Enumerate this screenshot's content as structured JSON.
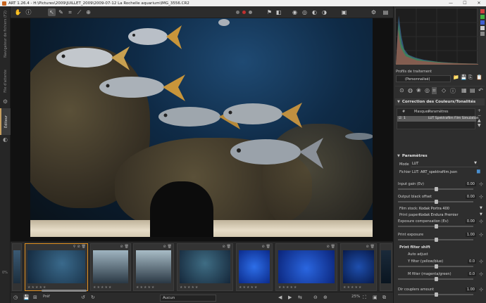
{
  "window": {
    "title": "ART 1.26.4 - H:\\Pictures\\2009\\JUILLET_2009\\2009-07-12 La Rochelle aquarium\\IMG_3556.CR2",
    "minimize": "—",
    "maximize": "☐",
    "close": "✕"
  },
  "left_tabs": {
    "browser": "Navigateur de fichiers (F2)",
    "queue": "File d'attente",
    "editor": "Éditeur"
  },
  "toolbar": {
    "icons": [
      "hand-tool",
      "info",
      "crop",
      "pipette",
      "white-balance",
      "straighten",
      "select"
    ]
  },
  "filmstrip": {
    "thumbnails": [
      {
        "id": "partial-left",
        "stars": ""
      },
      {
        "id": "fish-school",
        "stars": "★★★★★"
      },
      {
        "id": "diver-tank",
        "stars": "★★★★★"
      },
      {
        "id": "diver-tank-2",
        "stars": "★★★★★"
      },
      {
        "id": "fish-group",
        "stars": "★★★★★"
      },
      {
        "id": "jellyfish-blue",
        "stars": "★★★★★"
      },
      {
        "id": "jellyfish-wide",
        "stars": "★★★★★"
      },
      {
        "id": "moon-jelly",
        "stars": "★★★★★"
      },
      {
        "id": "partial-right",
        "stars": ""
      }
    ]
  },
  "bottombar": {
    "left_label": "0%",
    "preset_label": "Aucun",
    "fit_label": "Préf",
    "zoom": "25%"
  },
  "right_panel": {
    "profile_header": "Profils de traitement",
    "profile_value": "(Personnalisé)",
    "section_title": "Correction des Couleurs/Tonalités",
    "table_headers": {
      "num": "#",
      "masks": "Masques",
      "params": "Paramètres"
    },
    "table_row": {
      "num": "1",
      "params": "LUT Spektrafilm Film Simulation"
    },
    "params_header": "Paramètres",
    "mode_label": "Mode",
    "mode_value": "LUT",
    "lut_label": "Fichier LUT:",
    "lut_value": "ART_spektrafilm.json",
    "sliders": [
      {
        "label": "Input gain (Ev)",
        "value": "0.00",
        "pos": 0.5
      },
      {
        "label": "Output black offset",
        "value": "0.00",
        "pos": 0.5
      },
      {
        "label": "Exposure compensation (Ev)",
        "value": "0.00",
        "pos": 0.5
      },
      {
        "label": "Print exposure",
        "value": "1.00",
        "pos": 0.5
      },
      {
        "label": "Y filter (yellow/blue)",
        "value": "0.0",
        "pos": 0.5
      },
      {
        "label": "M filter (magenta/green)",
        "value": "0.0",
        "pos": 0.5
      },
      {
        "label": "Dir couplers amount",
        "value": "1.00",
        "pos": 0.5
      }
    ],
    "film_stock_label": "Film stock:",
    "film_stock_value": "Kodak Portra 400",
    "print_paper_label": "Print paper:",
    "print_paper_value": "Kodak Endura Premier",
    "print_filter_shift": "Print filter shift",
    "auto_adjust": "Auto adjust"
  },
  "colors": {
    "accent": "#e09020",
    "panel": "#2e2e2e",
    "histo_red": "#d04040",
    "histo_green": "#40b040",
    "histo_blue": "#4060d0"
  }
}
